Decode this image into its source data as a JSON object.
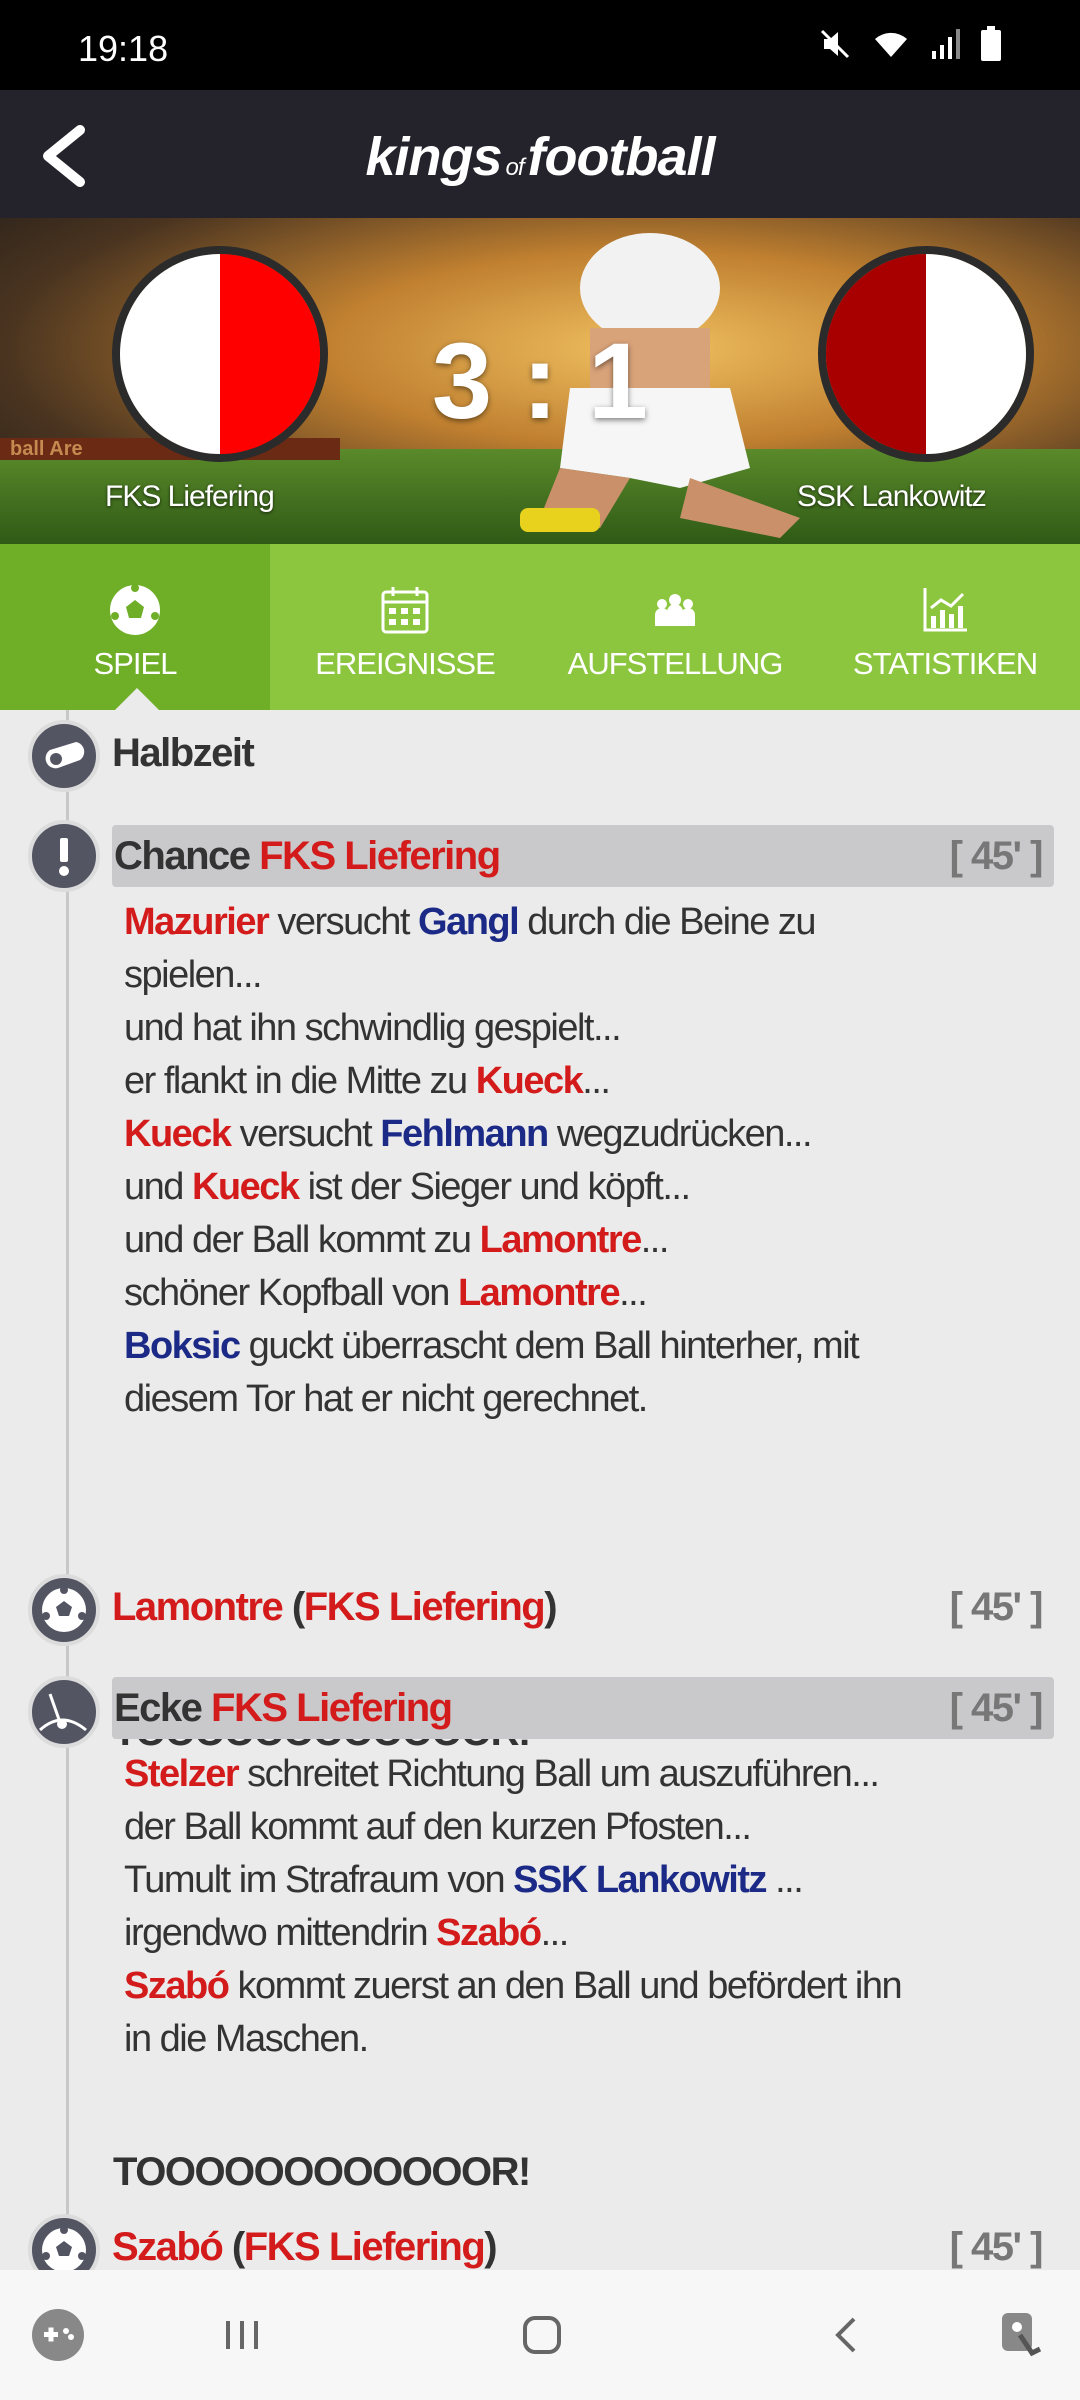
{
  "status": {
    "time": "19:18"
  },
  "app": {
    "logo_main1": "kings",
    "logo_of": "of",
    "logo_main2": "football"
  },
  "match": {
    "home_team": "FKS Liefering",
    "away_team": "SSK Lankowitz",
    "score": "3 : 1",
    "home_colors": [
      "#ffffff",
      "#ff0000"
    ],
    "away_colors": [
      "#a80000",
      "#ffffff"
    ],
    "banner_text": "ball Are"
  },
  "tabs": [
    {
      "label": "SPIEL",
      "icon": "soccer-ball-icon",
      "active": true
    },
    {
      "label": "EREIGNISSE",
      "icon": "calendar-icon",
      "active": false
    },
    {
      "label": "AUFSTELLUNG",
      "icon": "team-icon",
      "active": false
    },
    {
      "label": "STATISTIKEN",
      "icon": "chart-icon",
      "active": false
    }
  ],
  "events": {
    "halftime": {
      "label": "Halbzeit",
      "icon": "whistle-icon"
    },
    "chance": {
      "type": "Chance",
      "team": "FKS Liefering",
      "minute": "[ 45' ]",
      "icon": "exclamation-icon",
      "lines": [
        [
          [
            "r",
            "Mazurier"
          ],
          [
            "t",
            " versucht "
          ],
          [
            "b",
            "Gangl"
          ],
          [
            "t",
            " durch die Beine zu"
          ]
        ],
        [
          [
            "t",
            "spielen..."
          ]
        ],
        [
          [
            "t",
            "und hat ihn schwindlig gespielt..."
          ]
        ],
        [
          [
            "t",
            "er flankt in die Mitte zu "
          ],
          [
            "r",
            "Kueck"
          ],
          [
            "t",
            "..."
          ]
        ],
        [
          [
            "r",
            "Kueck"
          ],
          [
            "t",
            " versucht "
          ],
          [
            "b",
            "Fehlmann"
          ],
          [
            "t",
            " wegzudrücken..."
          ]
        ],
        [
          [
            "t",
            "und "
          ],
          [
            "r",
            "Kueck"
          ],
          [
            "t",
            " ist der Sieger und köpft..."
          ]
        ],
        [
          [
            "t",
            "und der Ball kommt zu "
          ],
          [
            "r",
            "Lamontre"
          ],
          [
            "t",
            "..."
          ]
        ],
        [
          [
            "t",
            "schöner Kopfball von "
          ],
          [
            "r",
            "Lamontre"
          ],
          [
            "t",
            "..."
          ]
        ],
        [
          [
            "b",
            "Boksic"
          ],
          [
            "t",
            " guckt überrascht dem Ball hinterher, mit"
          ]
        ],
        [
          [
            "t",
            "diesem Tor hat er nicht gerechnet."
          ]
        ]
      ],
      "goal_text": "TOOOOOOOOOOOOR!"
    },
    "goal1": {
      "player": "Lamontre",
      "team": "FKS Liefering",
      "minute": "[ 45' ]",
      "icon": "soccer-ball-icon"
    },
    "corner": {
      "type": "Ecke",
      "team": "FKS Liefering",
      "minute": "[ 45' ]",
      "icon": "corner-flag-icon",
      "lines": [
        [
          [
            "r",
            "Stelzer"
          ],
          [
            "t",
            " schreitet Richtung Ball um auszuführen..."
          ]
        ],
        [
          [
            "t",
            "der Ball kommt auf den kurzen Pfosten..."
          ]
        ],
        [
          [
            "t",
            "Tumult im Strafraum von "
          ],
          [
            "b",
            "SSK Lankowitz"
          ],
          [
            "t",
            " ..."
          ]
        ],
        [
          [
            "t",
            "irgendwo mittendrin "
          ],
          [
            "r",
            "Szabó"
          ],
          [
            "t",
            "..."
          ]
        ],
        [
          [
            "r",
            "Szabó"
          ],
          [
            "t",
            " kommt zuerst an den Ball und befördert ihn"
          ]
        ],
        [
          [
            "t",
            "in die Maschen."
          ]
        ]
      ],
      "goal_text": "TOOOOOOOOOOOOR!"
    },
    "goal2": {
      "player": "Szabó",
      "team": "FKS Liefering",
      "minute": "[ 45' ]",
      "icon": "soccer-ball-icon"
    }
  },
  "colors": {
    "accent_green": "#8cc63f",
    "active_tab": "#6fae27",
    "home_red": "#d41b1b",
    "away_blue": "#1b2a86"
  }
}
